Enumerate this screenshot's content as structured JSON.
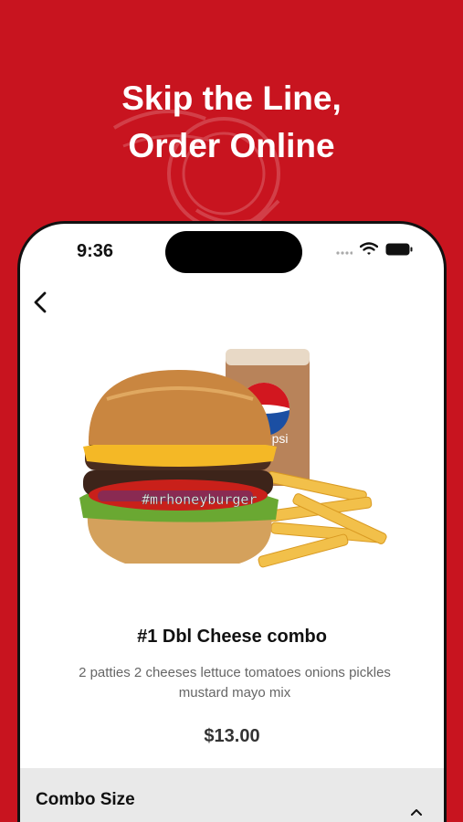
{
  "promo": {
    "headline_line1": "Skip the Line,",
    "headline_line2": "Order Online"
  },
  "status_bar": {
    "time": "9:36",
    "icons": [
      "signal-icon",
      "wifi-icon",
      "battery-icon"
    ]
  },
  "navigation": {
    "back_icon": "chevron-left-icon"
  },
  "product": {
    "image_watermark": "#mrhoneyburger",
    "cup_brand": "pepsi",
    "title": "#1 Dbl Cheese combo",
    "description": "2 patties 2 cheeses lettuce tomatoes onions pickles mustard mayo mix",
    "price": "$13.00"
  },
  "options": {
    "combo_size_label": "Combo Size",
    "combo_size_icon": "chevron-up-icon"
  },
  "colors": {
    "brand_red": "#c8141f",
    "section_gray": "#e9e9e9",
    "text_dark": "#111111",
    "text_muted": "#666666"
  }
}
